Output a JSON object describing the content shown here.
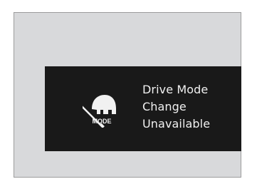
{
  "screen": {
    "background": "#d8d9db",
    "message_box_color": "#191919",
    "text_color": "#f0f0f0"
  },
  "message": {
    "icon": "drive-mode-unavailable-icon",
    "icon_text": "MODE",
    "lines": [
      "Drive Mode",
      "Change",
      "Unavailable"
    ]
  }
}
